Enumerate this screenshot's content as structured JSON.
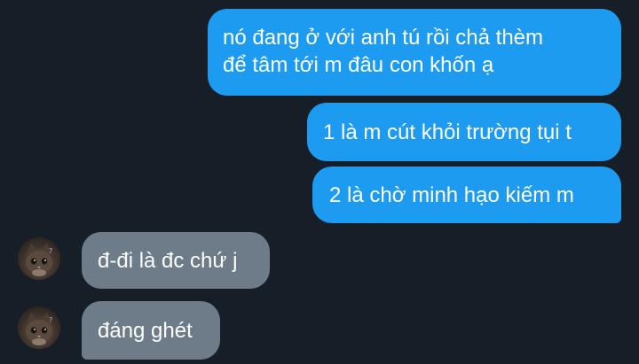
{
  "conversation": {
    "messages": [
      {
        "direction": "sent",
        "lines": [
          "nó đang ở với anh tú rồi chả thèm",
          "để tâm tới m đâu con khốn ạ"
        ]
      },
      {
        "direction": "sent",
        "lines": [
          "1 là m cút khỏi trường tụi t"
        ]
      },
      {
        "direction": "sent",
        "lines": [
          "2 là chờ minh hạo kiếm m"
        ]
      },
      {
        "direction": "received",
        "lines": [
          "đ-đi là đc chứ j"
        ]
      },
      {
        "direction": "received",
        "lines": [
          "đáng ghét"
        ]
      }
    ]
  },
  "colors": {
    "background": "#161e27",
    "sent_bubble": "#1d9bf0",
    "received_bubble": "#6e7c8a",
    "text": "#ffffff"
  },
  "icons": {
    "avatar": "cat-avatar-icon"
  }
}
